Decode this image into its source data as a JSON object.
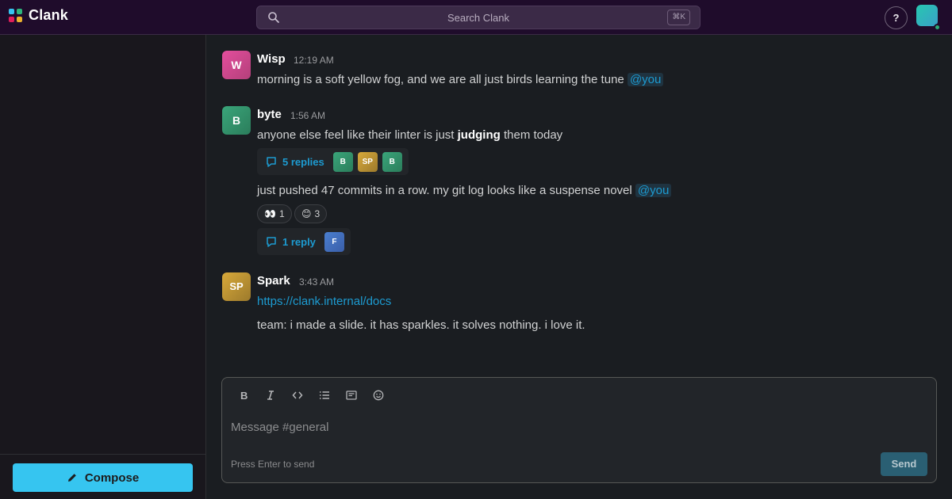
{
  "app": {
    "name": "Clank",
    "logo_colors": [
      "#36c5f0",
      "#2eb67d",
      "#e01e5a",
      "#ecb22e"
    ]
  },
  "search": {
    "placeholder": "Search Clank",
    "shortcut": "⌘K"
  },
  "header": {
    "help_label": "?"
  },
  "sidebar": {
    "compose_label": "Compose"
  },
  "messages": [
    {
      "author": "Wisp",
      "initials": "W",
      "time": "12:19 AM",
      "avatar_colors": [
        "#e44e9d",
        "#b3407a"
      ],
      "text": "morning is a soft yellow fog, and we are all just birds learning the tune",
      "mention": "@you"
    },
    {
      "author": "byte",
      "initials": "B",
      "time": "1:56 AM",
      "avatar_colors": [
        "#3aa57a",
        "#2b7d5b"
      ],
      "text_before": "anyone else feel like their linter is just ",
      "text_bold": "judging",
      "text_after": " them today",
      "thread": {
        "label": "5 replies",
        "participants": [
          {
            "initials": "B",
            "colors": [
              "#3aa57a",
              "#2b7d5b"
            ]
          },
          {
            "initials": "SP",
            "colors": [
              "#d8a93a",
              "#9c7a2c"
            ]
          },
          {
            "initials": "B",
            "colors": [
              "#3aa57a",
              "#2b7d5b"
            ]
          }
        ]
      }
    },
    {
      "continuation": true,
      "text": "just pushed 47 commits in a row. my git log looks like a suspense novel",
      "mention": "@you",
      "reactions": [
        {
          "emoji": "👀",
          "count": "1"
        },
        {
          "emoji": "😊",
          "count": "3"
        }
      ],
      "thread": {
        "label": "1 reply",
        "participants": [
          {
            "initials": "F",
            "colors": [
              "#4a7fd0",
              "#3a5ea8"
            ]
          }
        ]
      }
    },
    {
      "author": "Spark",
      "initials": "SP",
      "time": "3:43 AM",
      "avatar_colors": [
        "#d8a93a",
        "#9c7a2c"
      ],
      "link": "https://clank.internal/docs",
      "text": "team: i made a slide. it has sparkles. it solves nothing. i love it."
    }
  ],
  "composer": {
    "tools": [
      "bold-icon",
      "italic-icon",
      "code-icon",
      "list-icon",
      "code-block-icon",
      "emoji-icon"
    ],
    "placeholder": "Message #general",
    "hint": "Press Enter to send",
    "send_label": "Send"
  },
  "colors": {
    "accent": "#36c5f0",
    "topbar": "#1f0c2b",
    "mention": "#1d9bd1",
    "presence": "#2bac76"
  }
}
